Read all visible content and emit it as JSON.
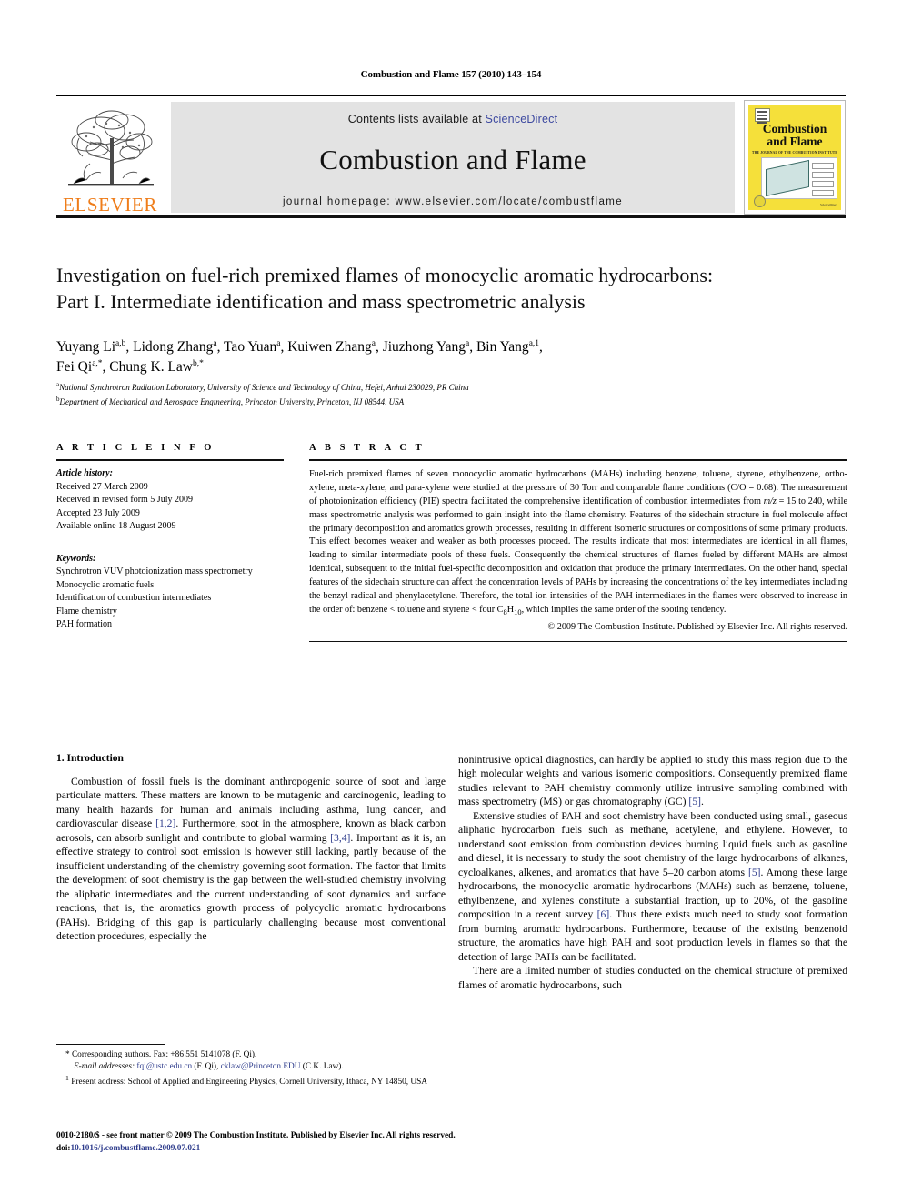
{
  "running_head": "Combustion and Flame 157 (2010) 143–154",
  "masthead": {
    "contents_prefix": "Contents lists available at ",
    "sciencedirect": "ScienceDirect",
    "journal_title": "Combustion and Flame",
    "homepage": "journal homepage: www.elsevier.com/locate/combustflame",
    "publisher_logo_text": "ELSEVIER",
    "cover": {
      "title_line1": "Combustion",
      "title_line2": "and Flame",
      "subtitle": "THE JOURNAL OF THE COMBUSTION INSTITUTE",
      "footer_note": "Available online at\nScienceDirect"
    },
    "link_color": "#3d49a0",
    "elsevier_orange": "#ef7d1a",
    "banner_bg": "#e3e3e3",
    "cover_bg": "#f5e03a"
  },
  "article": {
    "title_line1": "Investigation on fuel-rich premixed flames of monocyclic aromatic hydrocarbons:",
    "title_line2": "Part I. Intermediate identification and mass spectrometric analysis",
    "authors_line1": "Yuyang Li a,b, Lidong Zhang a, Tao Yuan a, Kuiwen Zhang a, Jiuzhong Yang a, Bin Yang a,1,",
    "authors_line2": "Fei Qi a,*, Chung K. Law b,*",
    "affiliation_a": "National Synchrotron Radiation Laboratory, University of Science and Technology of China, Hefei, Anhui 230029, PR China",
    "affiliation_b": "Department of Mechanical and Aerospace Engineering, Princeton University, Princeton, NJ 08544, USA"
  },
  "article_info": {
    "heading": "A R T I C L E    I N F O",
    "history_label": "Article history:",
    "history": [
      "Received 27 March 2009",
      "Received in revised form 5 July 2009",
      "Accepted 23 July 2009",
      "Available online 18 August 2009"
    ],
    "keywords_label": "Keywords:",
    "keywords": [
      "Synchrotron VUV photoionization mass spectrometry",
      "Monocyclic aromatic fuels",
      "Identification of combustion intermediates",
      "Flame chemistry",
      "PAH formation"
    ]
  },
  "abstract": {
    "heading": "A B S T R A C T",
    "text_part1": "Fuel-rich premixed flames of seven monocyclic aromatic hydrocarbons (MAHs) including benzene, toluene, styrene, ethylbenzene, ortho-xylene, meta-xylene, and para-xylene were studied at the pressure of 30 Torr and comparable flame conditions (C/O = 0.68). The measurement of photoionization efficiency (PIE) spectra facilitated the comprehensive identification of combustion intermediates from ",
    "mz_italic": "m/z",
    "text_part2": " = 15 to 240, while mass spectrometric analysis was performed to gain insight into the flame chemistry. Features of the sidechain structure in fuel molecule affect the primary decomposition and aromatics growth processes, resulting in different isomeric structures or compositions of some primary products. This effect becomes weaker and weaker as both processes proceed. The results indicate that most intermediates are identical in all flames, leading to similar intermediate pools of these fuels. Consequently the chemical structures of flames fueled by different MAHs are almost identical, subsequent to the initial fuel-specific decomposition and oxidation that produce the primary intermediates. On the other hand, special features of the sidechain structure can affect the concentration levels of PAHs by increasing the concentrations of the key intermediates including the benzyl radical and phenylacetylene. Therefore, the total ion intensities of the PAH intermediates in the flames were observed to increase in the order of: benzene < toluene and styrene < four C",
    "formula_sub1": "8",
    "formula_mid": "H",
    "formula_sub2": "10",
    "text_part3": ", which implies the same order of the sooting tendency.",
    "copyright": "© 2009 The Combustion Institute. Published by Elsevier Inc. All rights reserved."
  },
  "body": {
    "section_heading": "1. Introduction",
    "left_para1_a": "Combustion of fossil fuels is the dominant anthropogenic source of soot and large particulate matters. These matters are known to be mutagenic and carcinogenic, leading to many health hazards for human and animals including asthma, lung cancer, and cardiovascular disease ",
    "ref_1_2": "[1,2]",
    "left_para1_b": ". Furthermore, soot in the atmosphere, known as black carbon aerosols, can absorb sunlight and contribute to global warming ",
    "ref_3_4": "[3,4]",
    "left_para1_c": ". Important as it is, an effective strategy to control soot emission is however still lacking, partly because of the insufficient understanding of the chemistry governing soot formation. The factor that limits the development of soot chemistry is the gap between the well-studied chemistry involving the aliphatic intermediates and the current understanding of soot dynamics and surface reactions, that is, the aromatics growth process of polycyclic aromatic hydrocarbons (PAHs). Bridging of this gap is particularly challenging because most conventional detection procedures, especially the",
    "right_para1_a": "nonintrusive optical diagnostics, can hardly be applied to study this mass region due to the high molecular weights and various isomeric compositions. Consequently premixed flame studies relevant to PAH chemistry commonly utilize intrusive sampling combined with mass spectrometry (MS) or gas chromatography (GC) ",
    "ref_5a": "[5]",
    "right_para1_b": ".",
    "right_para2_a": "Extensive studies of PAH and soot chemistry have been conducted using small, gaseous aliphatic hydrocarbon fuels such as methane, acetylene, and ethylene. However, to understand soot emission from combustion devices burning liquid fuels such as gasoline and diesel, it is necessary to study the soot chemistry of the large hydrocarbons of alkanes, cycloalkanes, alkenes, and aromatics that have 5–20 carbon atoms ",
    "ref_5b": "[5]",
    "right_para2_b": ". Among these large hydrocarbons, the monocyclic aromatic hydrocarbons (MAHs) such as benzene, toluene, ethylbenzene, and xylenes constitute a substantial fraction, up to 20%, of the gasoline composition in a recent survey ",
    "ref_6": "[6]",
    "right_para2_c": ". Thus there exists much need to study soot formation from burning aromatic hydrocarbons. Furthermore, because of the existing benzenoid structure, the aromatics have high PAH and soot production levels in flames so that the detection of large PAHs can be facilitated.",
    "right_para3": "There are a limited number of studies conducted on the chemical structure of premixed flames of aromatic hydrocarbons, such",
    "ref_color": "#2e3c8c"
  },
  "footnotes": {
    "corresponding": "Corresponding authors. Fax: +86 551 5141078 (F. Qi).",
    "email_label": "E-mail addresses:",
    "email_1": "fqi@ustc.edu.cn",
    "email_1_who": " (F. Qi), ",
    "email_2": "cklaw@Princeton.EDU",
    "email_2_who": " (C.K. Law).",
    "present_address": "Present address: School of Applied and Engineering Physics, Cornell University, Ithaca, NY 14850, USA",
    "marker_star": "*",
    "marker_one": "1"
  },
  "imprint": {
    "line1": "0010-2180/$ - see front matter © 2009 The Combustion Institute. Published by Elsevier Inc. All rights reserved.",
    "doi_prefix": "doi:",
    "doi": "10.1016/j.combustflame.2009.07.021"
  }
}
